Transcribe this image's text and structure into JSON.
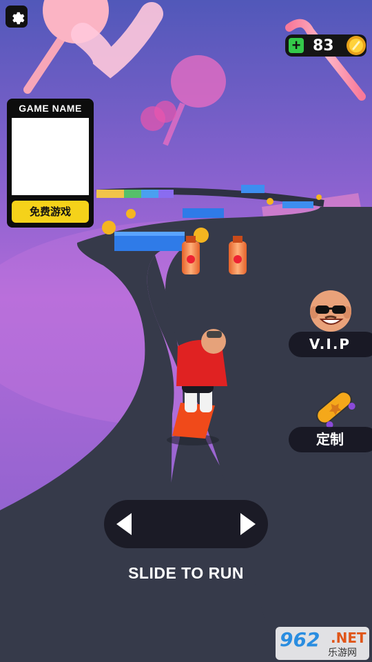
{
  "hud": {
    "coins": "83"
  },
  "ad": {
    "title": "GAME NAME",
    "button_label": "免费游戏"
  },
  "side_menu": {
    "vip_label": "V.I.P",
    "customize_label": "定制"
  },
  "controls": {
    "hint": "SLIDE TO RUN"
  },
  "watermark": {
    "number": "962",
    "domain": ".NET",
    "subtitle": "乐游网"
  },
  "colors": {
    "road": "#363a4a",
    "sky_top": "#4f56b8",
    "sky_bottom": "#b06ad8",
    "coin_plus": "#34c94a",
    "ad_button": "#f5d21a",
    "hoodie": "#e02222",
    "skateboard": "#f04a1a"
  }
}
